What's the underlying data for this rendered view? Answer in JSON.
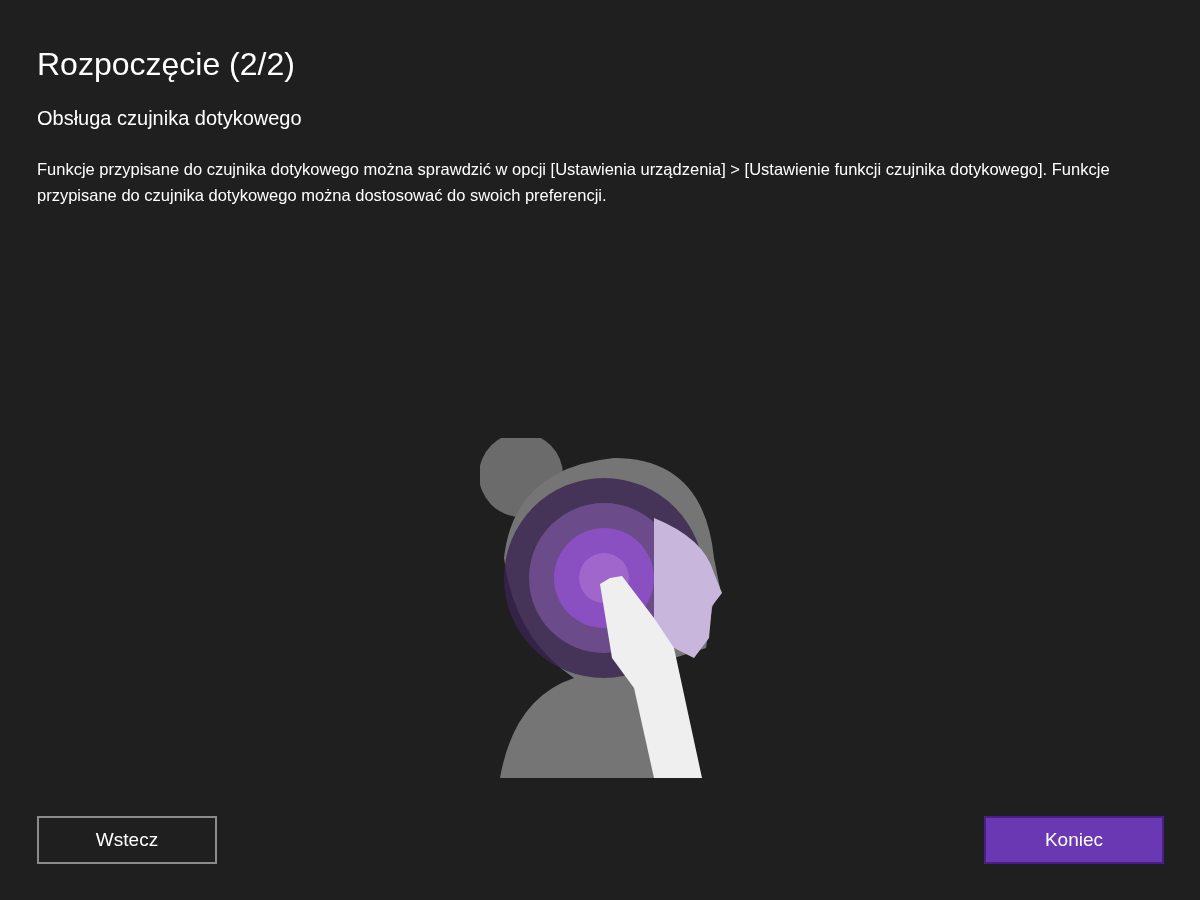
{
  "title": "Rozpoczęcie (2/2)",
  "subtitle": "Obsługa czujnika dotykowego",
  "description": "Funkcje przypisane do czujnika dotykowego można sprawdzić w opcji [Ustawienia urządzenia] > [Ustawienie funkcji czujnika dotykowego]. Funkcje przypisane do czujnika dotykowego można dostosować do swoich preferencji.",
  "buttons": [
    {
      "label": "Wstecz",
      "kind": "secondary"
    },
    {
      "label": "Koniec",
      "kind": "primary"
    }
  ]
}
